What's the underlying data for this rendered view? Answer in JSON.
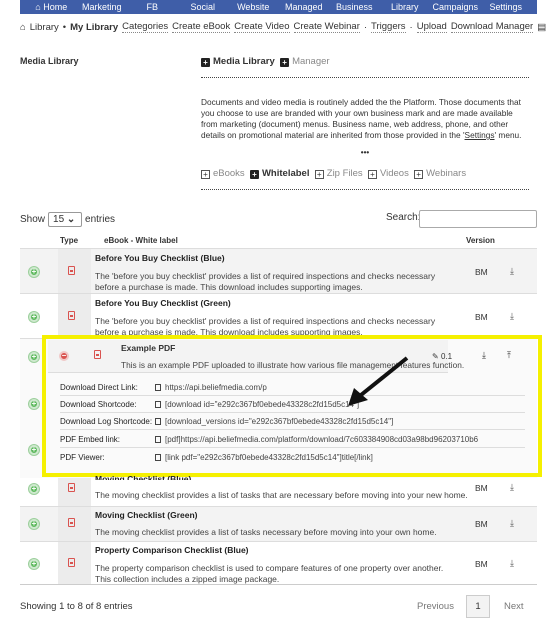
{
  "nav": {
    "items": [
      "Home",
      "Marketing",
      "FB",
      "Social",
      "Website",
      "Managed",
      "Business",
      "Library",
      "Campaigns",
      "Settings"
    ]
  },
  "breadcrumb": {
    "library": "Library",
    "current": "My Library",
    "links": [
      "Categories",
      "Create eBook",
      "Create Video",
      "Create Webinar",
      "Triggers",
      "Upload",
      "Download Manager"
    ]
  },
  "section": {
    "label": "Media Library",
    "tabs": [
      "Media Library",
      "Manager"
    ],
    "description_pre": "Documents and video media is routinely added the the Platform. Those documents that you choose to use are branded with your own business mark and are made available from marketing (document) menus. Business name, web address, phone, and other details on promotional material are inherited from those provided in the '",
    "settings_link": "Settings",
    "description_post": "' menu.",
    "ellipsis": "•••",
    "filters": [
      "eBooks",
      "Whitelabel",
      "Zip Files",
      "Videos",
      "Webinars"
    ],
    "active_filter": "Whitelabel"
  },
  "table": {
    "show_label": "Show",
    "entries_value": "15",
    "entries_label": "entries",
    "search_label": "Search:",
    "search_value": "",
    "headers": {
      "type": "Type",
      "title": "eBook - White label",
      "version": "Version"
    },
    "rows": [
      {
        "title": "Before You Buy Checklist (Blue)",
        "desc": "The 'before you buy checklist' provides a list of required inspections and checks necessary before a purchase is made. This download includes supporting images.",
        "version": "BM"
      },
      {
        "title": "Before You Buy Checklist (Green)",
        "desc": "The 'before you buy checklist' provides a list of required inspections and checks necessary before a purchase is made. This download includes supporting images.",
        "version": "BM"
      },
      {
        "title": "Moving Checklist (Blue)",
        "desc": "The moving checklist provides a list of tasks that are necessary before moving into your new home.",
        "version": "BM"
      },
      {
        "title": "Moving Checklist (Green)",
        "desc": "The moving checklist provides a list of tasks necessary before moving into your own home.",
        "version": "BM"
      },
      {
        "title": "Property Comparison Checklist (Blue)",
        "desc": "The property comparison checklist is used to compare features of one property over another. This collection includes a zipped image package.",
        "version": "BM"
      }
    ],
    "expanded": {
      "title": "Example PDF",
      "desc": "This is an example PDF uploaded to illustrate how various file management features function.",
      "version": "0.1",
      "details": [
        {
          "k": "Download Direct Link:",
          "v": "https://api.beliefmedia.com/p"
        },
        {
          "k": "Download Shortcode:",
          "v": "[download id=\"e292c367bf0ebede43328c2fd15d5c14\"]"
        },
        {
          "k": "Download Log Shortcode:",
          "v": "[download_versions id=\"e292c367bf0ebede43328c2fd15d5c14\"]"
        },
        {
          "k": "PDF Embed link:",
          "v": "[pdf]https://api.beliefmedia.com/platform/download/7c603384908cd03a98bd96203710b6"
        },
        {
          "k": "PDF Viewer:",
          "v": "[link pdf=\"e292c367bf0ebede43328c2fd15d5c14\"]title[/link]"
        }
      ]
    },
    "footer": {
      "info": "Showing 1 to 8 of 8 entries",
      "prev": "Previous",
      "page": "1",
      "next": "Next"
    }
  },
  "colors": {
    "nav": "#3f5ea8",
    "highlight": "#f5f000",
    "add": "#5cb85c",
    "remove": "#d9534f"
  }
}
